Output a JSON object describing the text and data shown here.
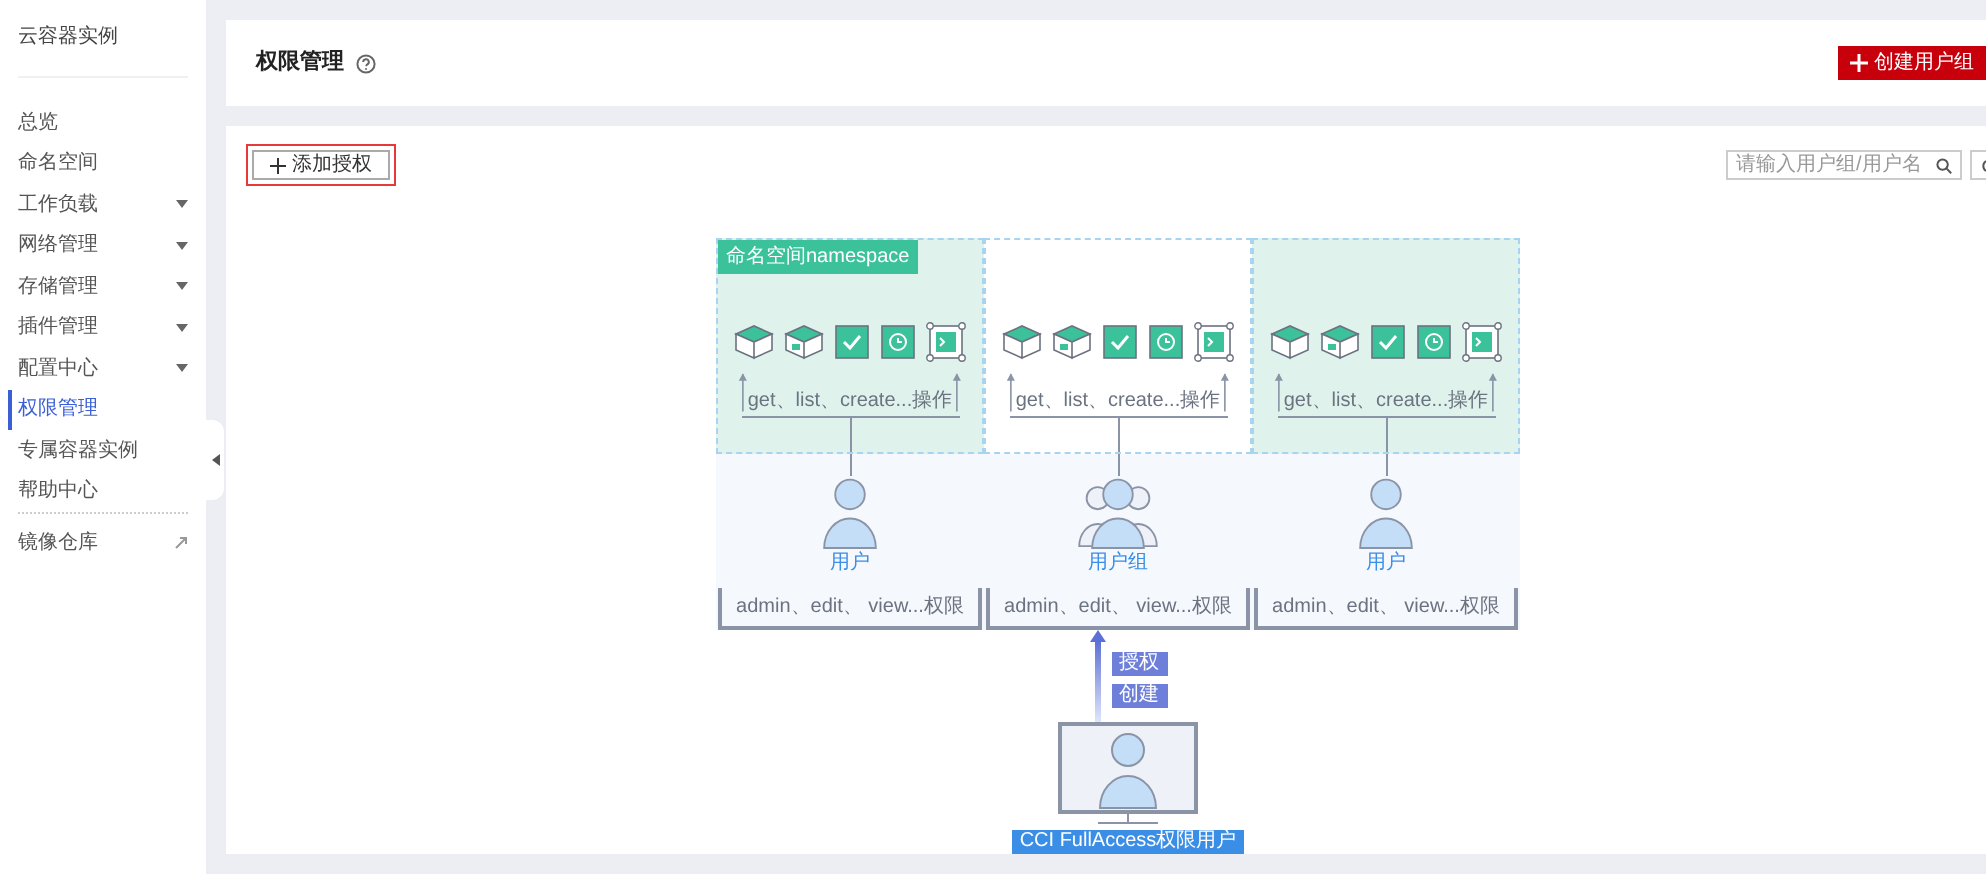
{
  "sidebar": {
    "title": "云容器实例",
    "items": [
      {
        "label": "总览",
        "selected": false,
        "expandable": false,
        "external": false
      },
      {
        "label": "命名空间",
        "selected": false,
        "expandable": false,
        "external": false
      },
      {
        "label": "工作负载",
        "selected": false,
        "expandable": true,
        "external": false
      },
      {
        "label": "网络管理",
        "selected": false,
        "expandable": true,
        "external": false
      },
      {
        "label": "存储管理",
        "selected": false,
        "expandable": true,
        "external": false
      },
      {
        "label": "插件管理",
        "selected": false,
        "expandable": true,
        "external": false
      },
      {
        "label": "配置中心",
        "selected": false,
        "expandable": true,
        "external": false
      },
      {
        "label": "权限管理",
        "selected": true,
        "expandable": false,
        "external": false
      },
      {
        "label": "专属容器实例",
        "selected": false,
        "expandable": false,
        "external": false
      },
      {
        "label": "帮助中心",
        "selected": false,
        "expandable": false,
        "external": false
      },
      {
        "label": "镜像仓库",
        "selected": false,
        "expandable": false,
        "external": true
      }
    ]
  },
  "header": {
    "title": "权限管理",
    "create_button": "创建用户组"
  },
  "toolbar": {
    "add_button": "添加授权",
    "search": {
      "placeholder": "请输入用户组/用户名"
    }
  },
  "diagram": {
    "namespace_label": "命名空间namespace",
    "columns": [
      {
        "kind": "user",
        "highlighted": true,
        "operations": "get、list、create...操作",
        "label": "用户",
        "permissions": "admin、edit、 view...权限"
      },
      {
        "kind": "group",
        "highlighted": false,
        "operations": "get、list、create...操作",
        "label": "用户组",
        "permissions": "admin、edit、 view...权限"
      },
      {
        "kind": "user",
        "highlighted": true,
        "operations": "get、list、create...操作",
        "label": "用户",
        "permissions": "admin、edit、 view...权限"
      }
    ],
    "arrow_labels": [
      "授权",
      "创建"
    ],
    "account_label": "CCI FullAccess权限用户"
  }
}
